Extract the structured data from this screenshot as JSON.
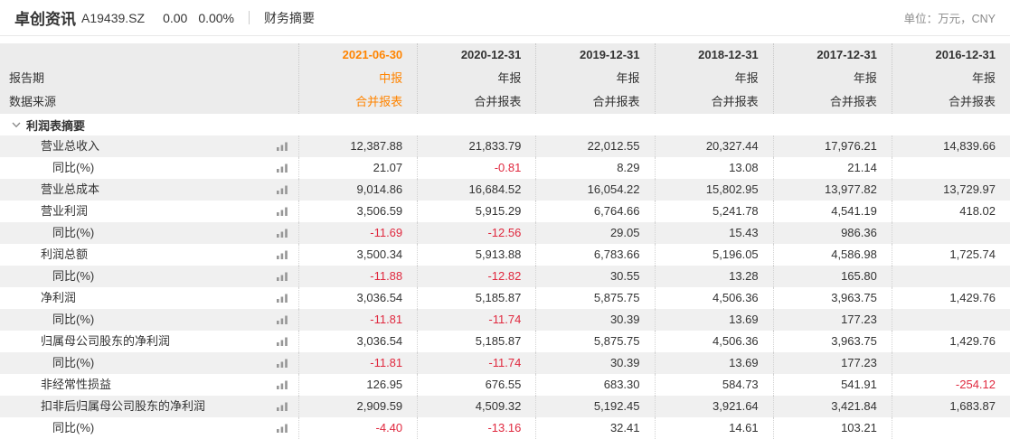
{
  "topbar": {
    "company": "卓创资讯",
    "code": "A19439.SZ",
    "price": "0.00",
    "change_pct": "0.00%",
    "tab_financial_summary": "财务摘要",
    "unit": "单位：万元，CNY"
  },
  "table": {
    "row_header_labels": {
      "report_period": "报告期",
      "data_source": "数据来源"
    },
    "columns": [
      {
        "date": "2021-06-30",
        "period": "中报",
        "source": "合并报表",
        "highlight": true
      },
      {
        "date": "2020-12-31",
        "period": "年报",
        "source": "合并报表",
        "highlight": false
      },
      {
        "date": "2019-12-31",
        "period": "年报",
        "source": "合并报表",
        "highlight": false
      },
      {
        "date": "2018-12-31",
        "period": "年报",
        "source": "合并报表",
        "highlight": false
      },
      {
        "date": "2017-12-31",
        "period": "年报",
        "source": "合并报表",
        "highlight": false
      },
      {
        "date": "2016-12-31",
        "period": "年报",
        "source": "合并报表",
        "highlight": false
      }
    ],
    "section_title": "利润表摘要",
    "rows": [
      {
        "label": "营业总收入",
        "indent": 1,
        "values": [
          "12,387.88",
          "21,833.79",
          "22,012.55",
          "20,327.44",
          "17,976.21",
          "14,839.66"
        ]
      },
      {
        "label": "同比(%)",
        "indent": 2,
        "values": [
          "21.07",
          "-0.81",
          "8.29",
          "13.08",
          "21.14",
          ""
        ]
      },
      {
        "label": "营业总成本",
        "indent": 1,
        "values": [
          "9,014.86",
          "16,684.52",
          "16,054.22",
          "15,802.95",
          "13,977.82",
          "13,729.97"
        ]
      },
      {
        "label": "营业利润",
        "indent": 1,
        "values": [
          "3,506.59",
          "5,915.29",
          "6,764.66",
          "5,241.78",
          "4,541.19",
          "418.02"
        ]
      },
      {
        "label": "同比(%)",
        "indent": 2,
        "values": [
          "-11.69",
          "-12.56",
          "29.05",
          "15.43",
          "986.36",
          ""
        ]
      },
      {
        "label": "利润总额",
        "indent": 1,
        "values": [
          "3,500.34",
          "5,913.88",
          "6,783.66",
          "5,196.05",
          "4,586.98",
          "1,725.74"
        ]
      },
      {
        "label": "同比(%)",
        "indent": 2,
        "values": [
          "-11.88",
          "-12.82",
          "30.55",
          "13.28",
          "165.80",
          ""
        ]
      },
      {
        "label": "净利润",
        "indent": 1,
        "values": [
          "3,036.54",
          "5,185.87",
          "5,875.75",
          "4,506.36",
          "3,963.75",
          "1,429.76"
        ]
      },
      {
        "label": "同比(%)",
        "indent": 2,
        "values": [
          "-11.81",
          "-11.74",
          "30.39",
          "13.69",
          "177.23",
          ""
        ]
      },
      {
        "label": "归属母公司股东的净利润",
        "indent": 1,
        "values": [
          "3,036.54",
          "5,185.87",
          "5,875.75",
          "4,506.36",
          "3,963.75",
          "1,429.76"
        ]
      },
      {
        "label": "同比(%)",
        "indent": 2,
        "values": [
          "-11.81",
          "-11.74",
          "30.39",
          "13.69",
          "177.23",
          ""
        ]
      },
      {
        "label": "非经常性损益",
        "indent": 1,
        "values": [
          "126.95",
          "676.55",
          "683.30",
          "584.73",
          "541.91",
          "-254.12"
        ]
      },
      {
        "label": "扣非后归属母公司股东的净利润",
        "indent": 1,
        "values": [
          "2,909.59",
          "4,509.32",
          "5,192.45",
          "3,921.64",
          "3,421.84",
          "1,683.87"
        ]
      },
      {
        "label": "同比(%)",
        "indent": 2,
        "values": [
          "-4.40",
          "-13.16",
          "32.41",
          "14.61",
          "103.21",
          ""
        ]
      }
    ]
  },
  "icons": {
    "chevron": "chevron-down-icon",
    "row_chart": "bar-chart-icon"
  },
  "colors": {
    "accent_orange": "#ff8400",
    "negative_red": "#e0293f",
    "text_dark": "#333333",
    "stripe_gray": "#f0f0f0",
    "header_band_gray": "#ececec"
  }
}
